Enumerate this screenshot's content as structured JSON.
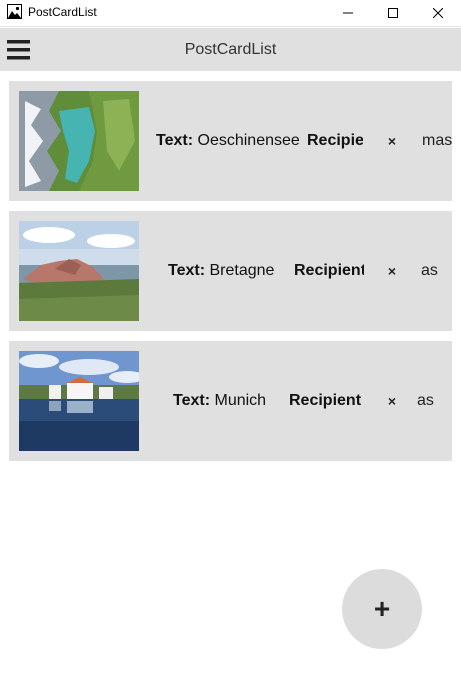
{
  "window": {
    "title": "PostCardList"
  },
  "toolbar": {
    "title": "PostCardList",
    "menu_icon": "hamburger-icon"
  },
  "cards": [
    {
      "text_label": "Text:",
      "text_value": "Oeschinensee",
      "recipient_label": "Recipient",
      "remove_label": "×",
      "extra_value": "mas"
    },
    {
      "text_label": "Text:",
      "text_value": "Bretagne",
      "recipient_label": "Recipient",
      "remove_label": "×",
      "extra_value": "as"
    },
    {
      "text_label": "Text:",
      "text_value": "Munich",
      "recipient_label": "Recipient",
      "remove_label": "×",
      "extra_value": "as"
    }
  ],
  "fab": {
    "label": "+"
  }
}
